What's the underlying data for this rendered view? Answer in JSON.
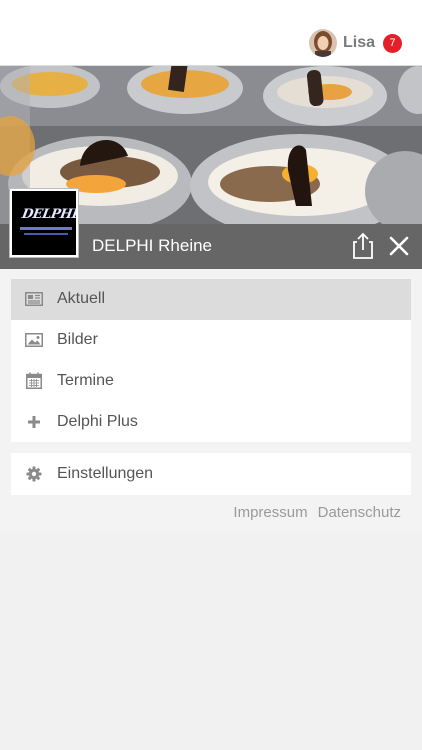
{
  "user": {
    "name": "Lisa",
    "notification_count": "7"
  },
  "venue": {
    "name": "DELPHI Rheine",
    "logo_text": "DELPHI"
  },
  "menu": {
    "items": [
      {
        "label": "Aktuell",
        "icon": "newspaper-icon",
        "active": true
      },
      {
        "label": "Bilder",
        "icon": "image-icon",
        "active": false
      },
      {
        "label": "Termine",
        "icon": "calendar-icon",
        "active": false
      },
      {
        "label": "Delphi Plus",
        "icon": "plus-icon",
        "active": false
      }
    ],
    "settings": {
      "label": "Einstellungen",
      "icon": "gear-icon"
    }
  },
  "footer": {
    "impressum": "Impressum",
    "datenschutz": "Datenschutz"
  },
  "colors": {
    "badge": "#e3202a",
    "venue_bar": "#5a5a5a",
    "active_item": "#dcdcdc",
    "icon": "#8a8a8a"
  }
}
